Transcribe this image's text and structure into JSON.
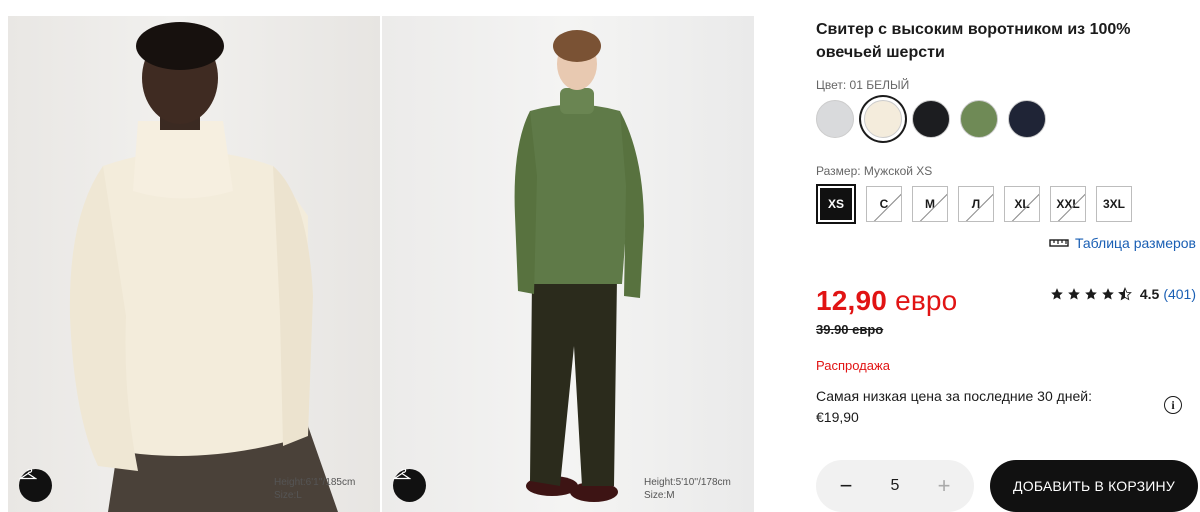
{
  "gallery": {
    "photos": [
      {
        "model_height": "Height:6'1''/185cm",
        "model_size": "Size:L"
      },
      {
        "model_height": "Height:5'10''/178cm",
        "model_size": "Size:M"
      }
    ]
  },
  "product": {
    "title": "Свитер с высоким воротником из 100% овечьей шерсти",
    "color_label": "Цвет: 01 БЕЛЫЙ",
    "colors": [
      {
        "name": "grey",
        "hex": "#d9dadc"
      },
      {
        "name": "white",
        "hex": "#f4ecdc",
        "selected": true
      },
      {
        "name": "black",
        "hex": "#1c1d20"
      },
      {
        "name": "green",
        "hex": "#6f8a56"
      },
      {
        "name": "navy",
        "hex": "#1f2436"
      }
    ],
    "size_label": "Размер: Мужской XS",
    "sizes": [
      {
        "label": "XS",
        "selected": true
      },
      {
        "label": "C",
        "available": false
      },
      {
        "label": "M",
        "available": false
      },
      {
        "label": "Л",
        "available": false
      },
      {
        "label": "XL",
        "available": false
      },
      {
        "label": "XXL",
        "available": false
      },
      {
        "label": "3XL"
      }
    ],
    "size_table_link": "Таблица размеров",
    "price_amount": "12,90",
    "price_currency": "евро",
    "old_price": "39.90 евро",
    "rating": {
      "value": "4.5",
      "count": "(401)",
      "stars": 4.5
    },
    "sale_label": "Распродажа",
    "lowest_price_text": "Самая низкая цена за последние 30 дней:",
    "lowest_price_value": "€19,90",
    "quantity": "5",
    "add_to_cart": "ДОБАВИТЬ В КОРЗИНУ"
  },
  "colors": {
    "price_red": "#e11414",
    "link_blue": "#1a5fb4",
    "button_black": "#111111"
  }
}
